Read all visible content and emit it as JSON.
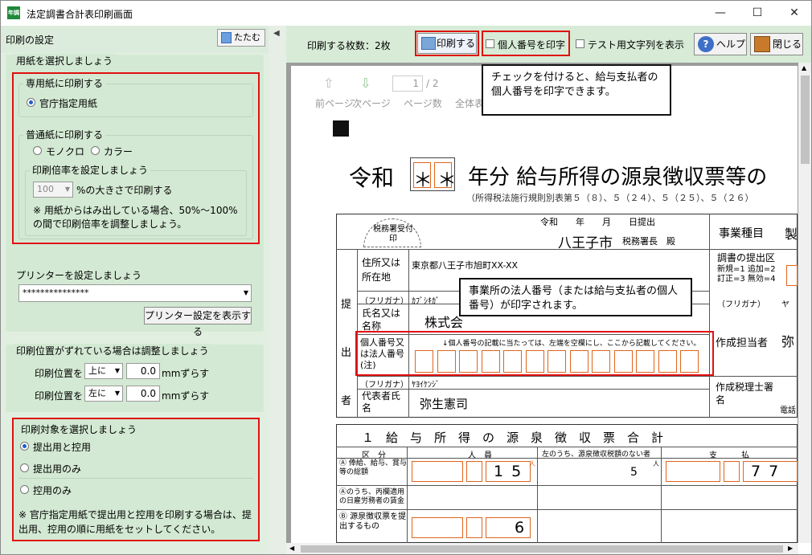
{
  "window": {
    "title": "法定調書合計表印刷画面",
    "app_icon_text": "年調"
  },
  "left_panel": {
    "title": "印刷の設定",
    "collapse_label": "たたむ",
    "paper": {
      "group_title": "用紙を選択しましょう",
      "dedicated_title": "専用紙に印刷する",
      "dedicated_option": "官庁指定用紙",
      "plain_title": "普通紙に印刷する",
      "mono": "モノクロ",
      "color": "カラー",
      "scale_title": "印刷倍率を設定しましょう",
      "scale_value": "100",
      "scale_suffix": "%の大きさで印刷する",
      "scale_note": "※ 用紙からはみ出している場合、50%～100%の間で印刷倍率を調整しましょう。"
    },
    "printer": {
      "group_title": "プリンターを設定しましょう",
      "printer_value": "***************",
      "show_settings": "プリンター設定を表示する"
    },
    "offset": {
      "group_title": "印刷位置がずれている場合は調整しましょう",
      "label": "印刷位置を",
      "vertical": "上に",
      "horizontal": "左に",
      "value1": "0.0",
      "value2": "0.0",
      "unit": "mmずらす"
    },
    "target": {
      "group_title": "印刷対象を選択しましょう",
      "opt1": "提出用と控用",
      "opt2": "提出用のみ",
      "opt3": "控用のみ",
      "note": "※ 官庁指定用紙で提出用と控用を印刷する場合は、提出用、控用の順に用紙をセットしてください。"
    }
  },
  "toolbar": {
    "sheet_count": "印刷する枚数：2枚",
    "print": "印刷する",
    "personal_number": "個人番号を印字",
    "test_text": "テスト用文字列を表示",
    "help": "ヘルプ",
    "close": "閉じる"
  },
  "viewer": {
    "prev": "前ページ",
    "next": "次ページ",
    "page_current": "1",
    "page_total": "/ 2",
    "page_count": "ページ数",
    "whole": "全体表"
  },
  "callouts": {
    "c1": "チェックを付けると、給与支払者の個人番号を印字できます。",
    "c2": "事業所の法人番号（または給与支払者の個人番号）が印字されます。"
  },
  "form": {
    "era": "令和",
    "asterisks": "＊＊",
    "title": "年分 給与所得の源泉徴収票等の",
    "subtitle": "（所得税法施行規則別表第５（８）、５（２４）、５（２５）、５（２６）",
    "stamp": "税務署受付印",
    "date_line": "令和　　年　　月　　日提出",
    "tax_office": "八王子市",
    "tax_office_suffix": "税務署長　殿",
    "business_type": "事業種目",
    "business_value": "製",
    "report_label": "調書の提出区",
    "report_codes": "新規=1 追加=2 訂正=3 無効=4",
    "address_label": "住所又は所在地",
    "address_value": "東京都八王子市旭町XX-XX",
    "provider_label": "提出者",
    "furigana": "（フリガナ）",
    "furigana_name": "ｶﾌﾞｼｷｶﾞ",
    "name_label": "氏名又は名称",
    "name_value": "株式会",
    "number_label": "個人番号又は法人番号(注)",
    "number_note": "↓個人番号の記載に当たっては、左端を空欄にし、ここから記載してください。",
    "furigana2": "（フリガナ）",
    "furigana_rep": "ﾔﾖｲｹﾝｼﾞ",
    "rep_label": "代表者氏名",
    "rep_value": "弥生憲司",
    "contact_label": "作成担当者",
    "contact_value": "弥",
    "tax_acct_label": "作成税理士署名",
    "phone": "電話",
    "furigana_r": "（フリガナ）",
    "furigana_r_val": "ヤ",
    "section_title": "１　給　与　所　得　の　源　泉　徴　収　票　合　計",
    "col_kubun": "区　分",
    "col_people": "人　員",
    "col_no_tax": "左のうち、源泉徴収税額のない者",
    "col_pay": "支　　　払",
    "row_a": "Ⓐ 俸給、給与、賞与等の総額",
    "row_a_people": "15",
    "row_a_none": "5",
    "row_a_pay": "77",
    "row_b": "Ⓐのうち、丙欄適用の日雇労務者の賃金",
    "row_c": "Ⓑ 源泉徴収票を提出するもの",
    "row_c_people": "6",
    "unit_people": "人"
  }
}
